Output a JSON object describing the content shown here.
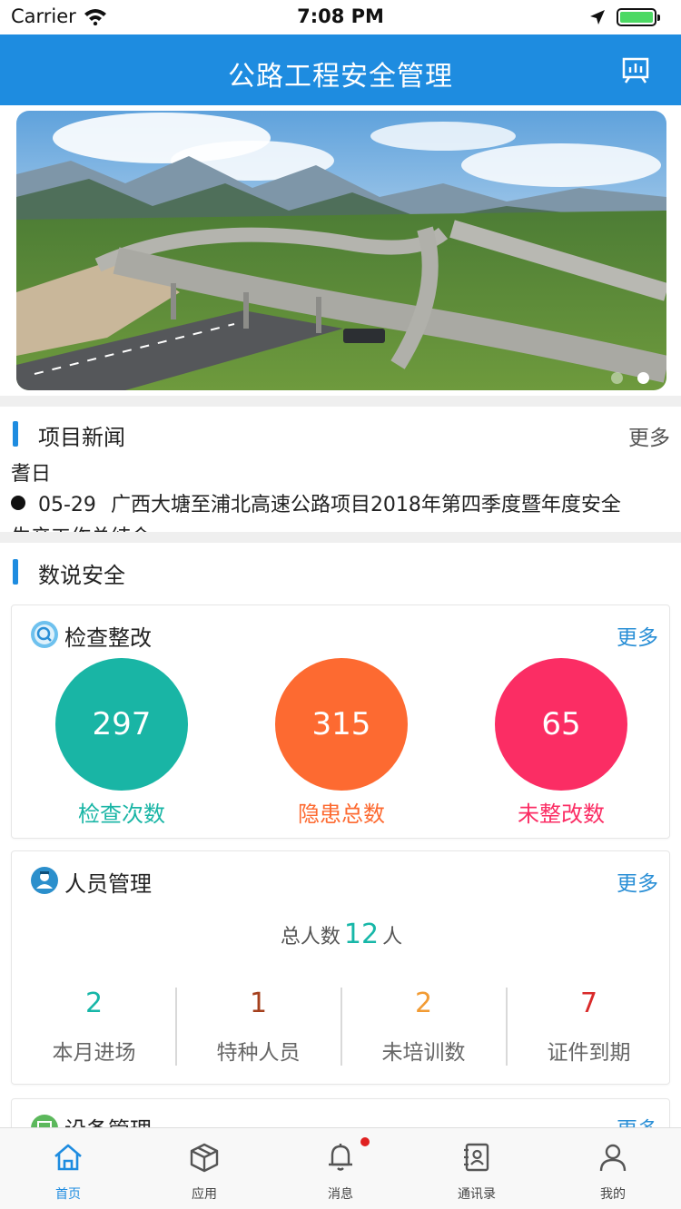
{
  "status_bar": {
    "carrier": "Carrier",
    "time": "7:08 PM"
  },
  "header": {
    "title": "公路工程安全管理",
    "action_icon": "chart-icon"
  },
  "banner": {
    "slide_count": 2,
    "active_slide": 2
  },
  "news": {
    "title": "项目新闻",
    "more": "更多",
    "subtitle": "耆日",
    "items": [
      {
        "date": "05-29",
        "text": "广西大塘至浦北高速公路项目2018年第四季度暨年度安全"
      }
    ],
    "clipped_next": "生产工作总结会"
  },
  "data_section": {
    "title": "数说安全",
    "inspection": {
      "title": "检查整改",
      "more": "更多",
      "icon": "search-icon",
      "stats": [
        {
          "value": "297",
          "label": "检查次数",
          "color": "#19b5a5"
        },
        {
          "value": "315",
          "label": "隐患总数",
          "color": "#fd6a31"
        },
        {
          "value": "65",
          "label": "未整改数",
          "color": "#fb2d64"
        }
      ]
    },
    "personnel": {
      "title": "人员管理",
      "more": "更多",
      "icon": "user-icon",
      "total_label": "总人数",
      "total_value": "12",
      "total_unit": "人",
      "stats": [
        {
          "value": "2",
          "label": "本月进场",
          "color": "#17b7a8"
        },
        {
          "value": "1",
          "label": "特种人员",
          "color": "#a5401d"
        },
        {
          "value": "2",
          "label": "未培训数",
          "color": "#f29b33"
        },
        {
          "value": "7",
          "label": "证件到期",
          "color": "#d92a2a"
        }
      ]
    },
    "equipment": {
      "title": "设备管理",
      "more": "更多",
      "icon": "equipment-icon"
    }
  },
  "tabbar": {
    "tabs": [
      {
        "label": "首页",
        "icon": "home-icon",
        "active": true
      },
      {
        "label": "应用",
        "icon": "box-icon",
        "active": false
      },
      {
        "label": "消息",
        "icon": "bell-icon",
        "active": false,
        "badge": true
      },
      {
        "label": "通讯录",
        "icon": "contacts-icon",
        "active": false
      },
      {
        "label": "我的",
        "icon": "profile-icon",
        "active": false
      }
    ]
  },
  "colors": {
    "primary": "#1e8ce0",
    "accent_blue": "#2a8fd6"
  }
}
